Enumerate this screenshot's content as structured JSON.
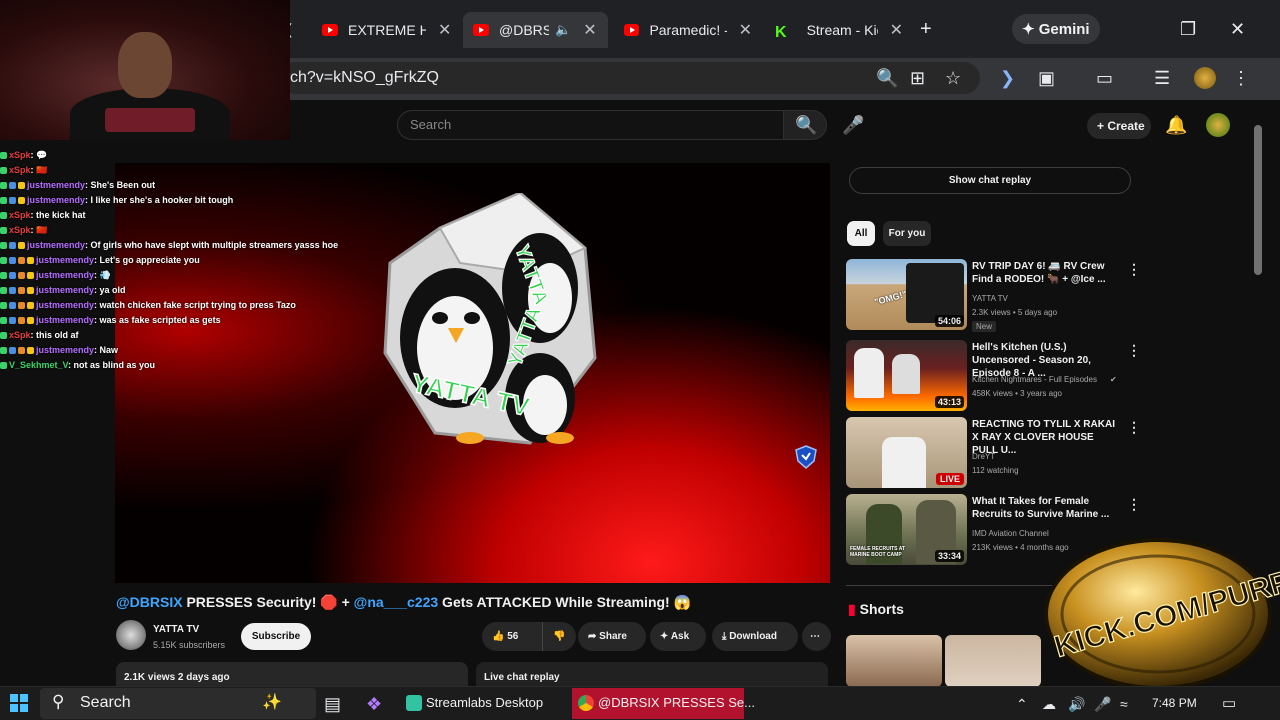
{
  "browser": {
    "tabs": [
      {
        "title": "EXTREME Ho",
        "favicon": "youtube-icon",
        "active": false
      },
      {
        "title": "@DBRSI",
        "favicon": "youtube-icon",
        "active": true
      },
      {
        "title": "Paramedic! -",
        "favicon": "youtube-icon",
        "active": false
      },
      {
        "title": "Stream - Kick",
        "favicon": "kick-icon",
        "active": false
      }
    ],
    "new_tab": "+",
    "gemini_label": "Gemini",
    "url_text": "ch?v=kNSO_gFrkZQ"
  },
  "youtube": {
    "search_placeholder": "Search",
    "create_label": "Create",
    "video": {
      "title_mention_1": "@DBRSIX",
      "title_part_1": " PRESSES Security! 🛑 + ",
      "title_mention_2": "@na___c223",
      "title_part_2": " Gets ATTACKED While Streaming! 😱",
      "channel_name": "YATTA TV",
      "subscribers": "5.15K subscribers",
      "subscribe_label": "Subscribe",
      "likes": "56",
      "share_label": "Share",
      "ask_label": "Ask",
      "download_label": "Download",
      "views_date": "2.1K views  2 days ago",
      "live_chat_replay": "Live chat replay",
      "dice_text_1": "YATTA TV",
      "dice_text_2": "YATTA",
      "dice_text_3": "YATTA"
    },
    "sidebar": {
      "show_chat_replay": "Show chat replay",
      "chips": [
        "All",
        "For you"
      ],
      "recommendations": [
        {
          "title": "RV TRIP DAY 6! 🚐 RV Crew Find a RODEO! 🐂 + @Ice ...",
          "channel": "YATTA TV",
          "meta": "2.3K views • 5 days ago",
          "badge": "New",
          "duration": "54:06",
          "thumb_text": "\"OMG!\""
        },
        {
          "title": "Hell's Kitchen (U.S.) Uncensored - Season 20, Episode 8 - A ...",
          "channel": "Kitchen Nightmares - Full Episodes",
          "meta": "458K views • 3 years ago",
          "duration": "43:13"
        },
        {
          "title": "REACTING TO TYLIL X RAKAI X RAY X CLOVER HOUSE PULL U...",
          "channel": "DreYT",
          "meta": "112 watching",
          "live_label": "LIVE"
        },
        {
          "title": "What It Takes for Female Recruits to Survive Marine ...",
          "channel": "IMD Aviation Channel",
          "meta": "213K views • 4 months ago",
          "duration": "33:34",
          "thumb_text": "FEMALE RECRUITS AT MARINE BOOT CAMP"
        }
      ],
      "shorts_label": "Shorts"
    }
  },
  "chat_overlay": {
    "messages": [
      {
        "user": "xSpk",
        "text": ": 💬",
        "color": "#e63c3c"
      },
      {
        "user": "xSpk",
        "text": ": 🇨🇳",
        "color": "#e63c3c"
      },
      {
        "user": "justmemendy",
        "text": ": She's Been out",
        "color": "#b46cff"
      },
      {
        "user": "justmemendy",
        "text": ": I like her she's a hooker bit tough",
        "color": "#b46cff"
      },
      {
        "user": "xSpk",
        "text": ": the kick hat",
        "color": "#e63c3c"
      },
      {
        "user": "xSpk",
        "text": ": 🇨🇳",
        "color": "#e63c3c"
      },
      {
        "user": "justmemendy",
        "text": ": Of girls who have slept with multiple streamers yasss hoe",
        "color": "#b46cff"
      },
      {
        "user": "justmemendy",
        "text": ": Let's go appreciate you",
        "color": "#b46cff"
      },
      {
        "user": "justmemendy",
        "text": ": 💨",
        "color": "#b46cff"
      },
      {
        "user": "justmemendy",
        "text": ": ya old",
        "color": "#b46cff"
      },
      {
        "user": "justmemendy",
        "text": ": watch chicken fake script trying to press Tazo",
        "color": "#b46cff"
      },
      {
        "user": "justmemendy",
        "text": ": was as fake scripted as gets",
        "color": "#b46cff"
      },
      {
        "user": "xSpk",
        "text": ": this old af",
        "color": "#e63c3c"
      },
      {
        "user": "justmemendy",
        "text": ": Naw",
        "color": "#b46cff"
      },
      {
        "user": "V_Sekhmet_V",
        "text": ": not as blind as you",
        "color": "#3cd26b"
      }
    ]
  },
  "kick_logo_text": "KICK.COM/PURP",
  "taskbar": {
    "search_label": "Search",
    "apps": [
      {
        "label": "Streamlabs Desktop"
      },
      {
        "label": "@DBRSIX PRESSES Se..."
      }
    ],
    "time": "7:48 PM"
  }
}
